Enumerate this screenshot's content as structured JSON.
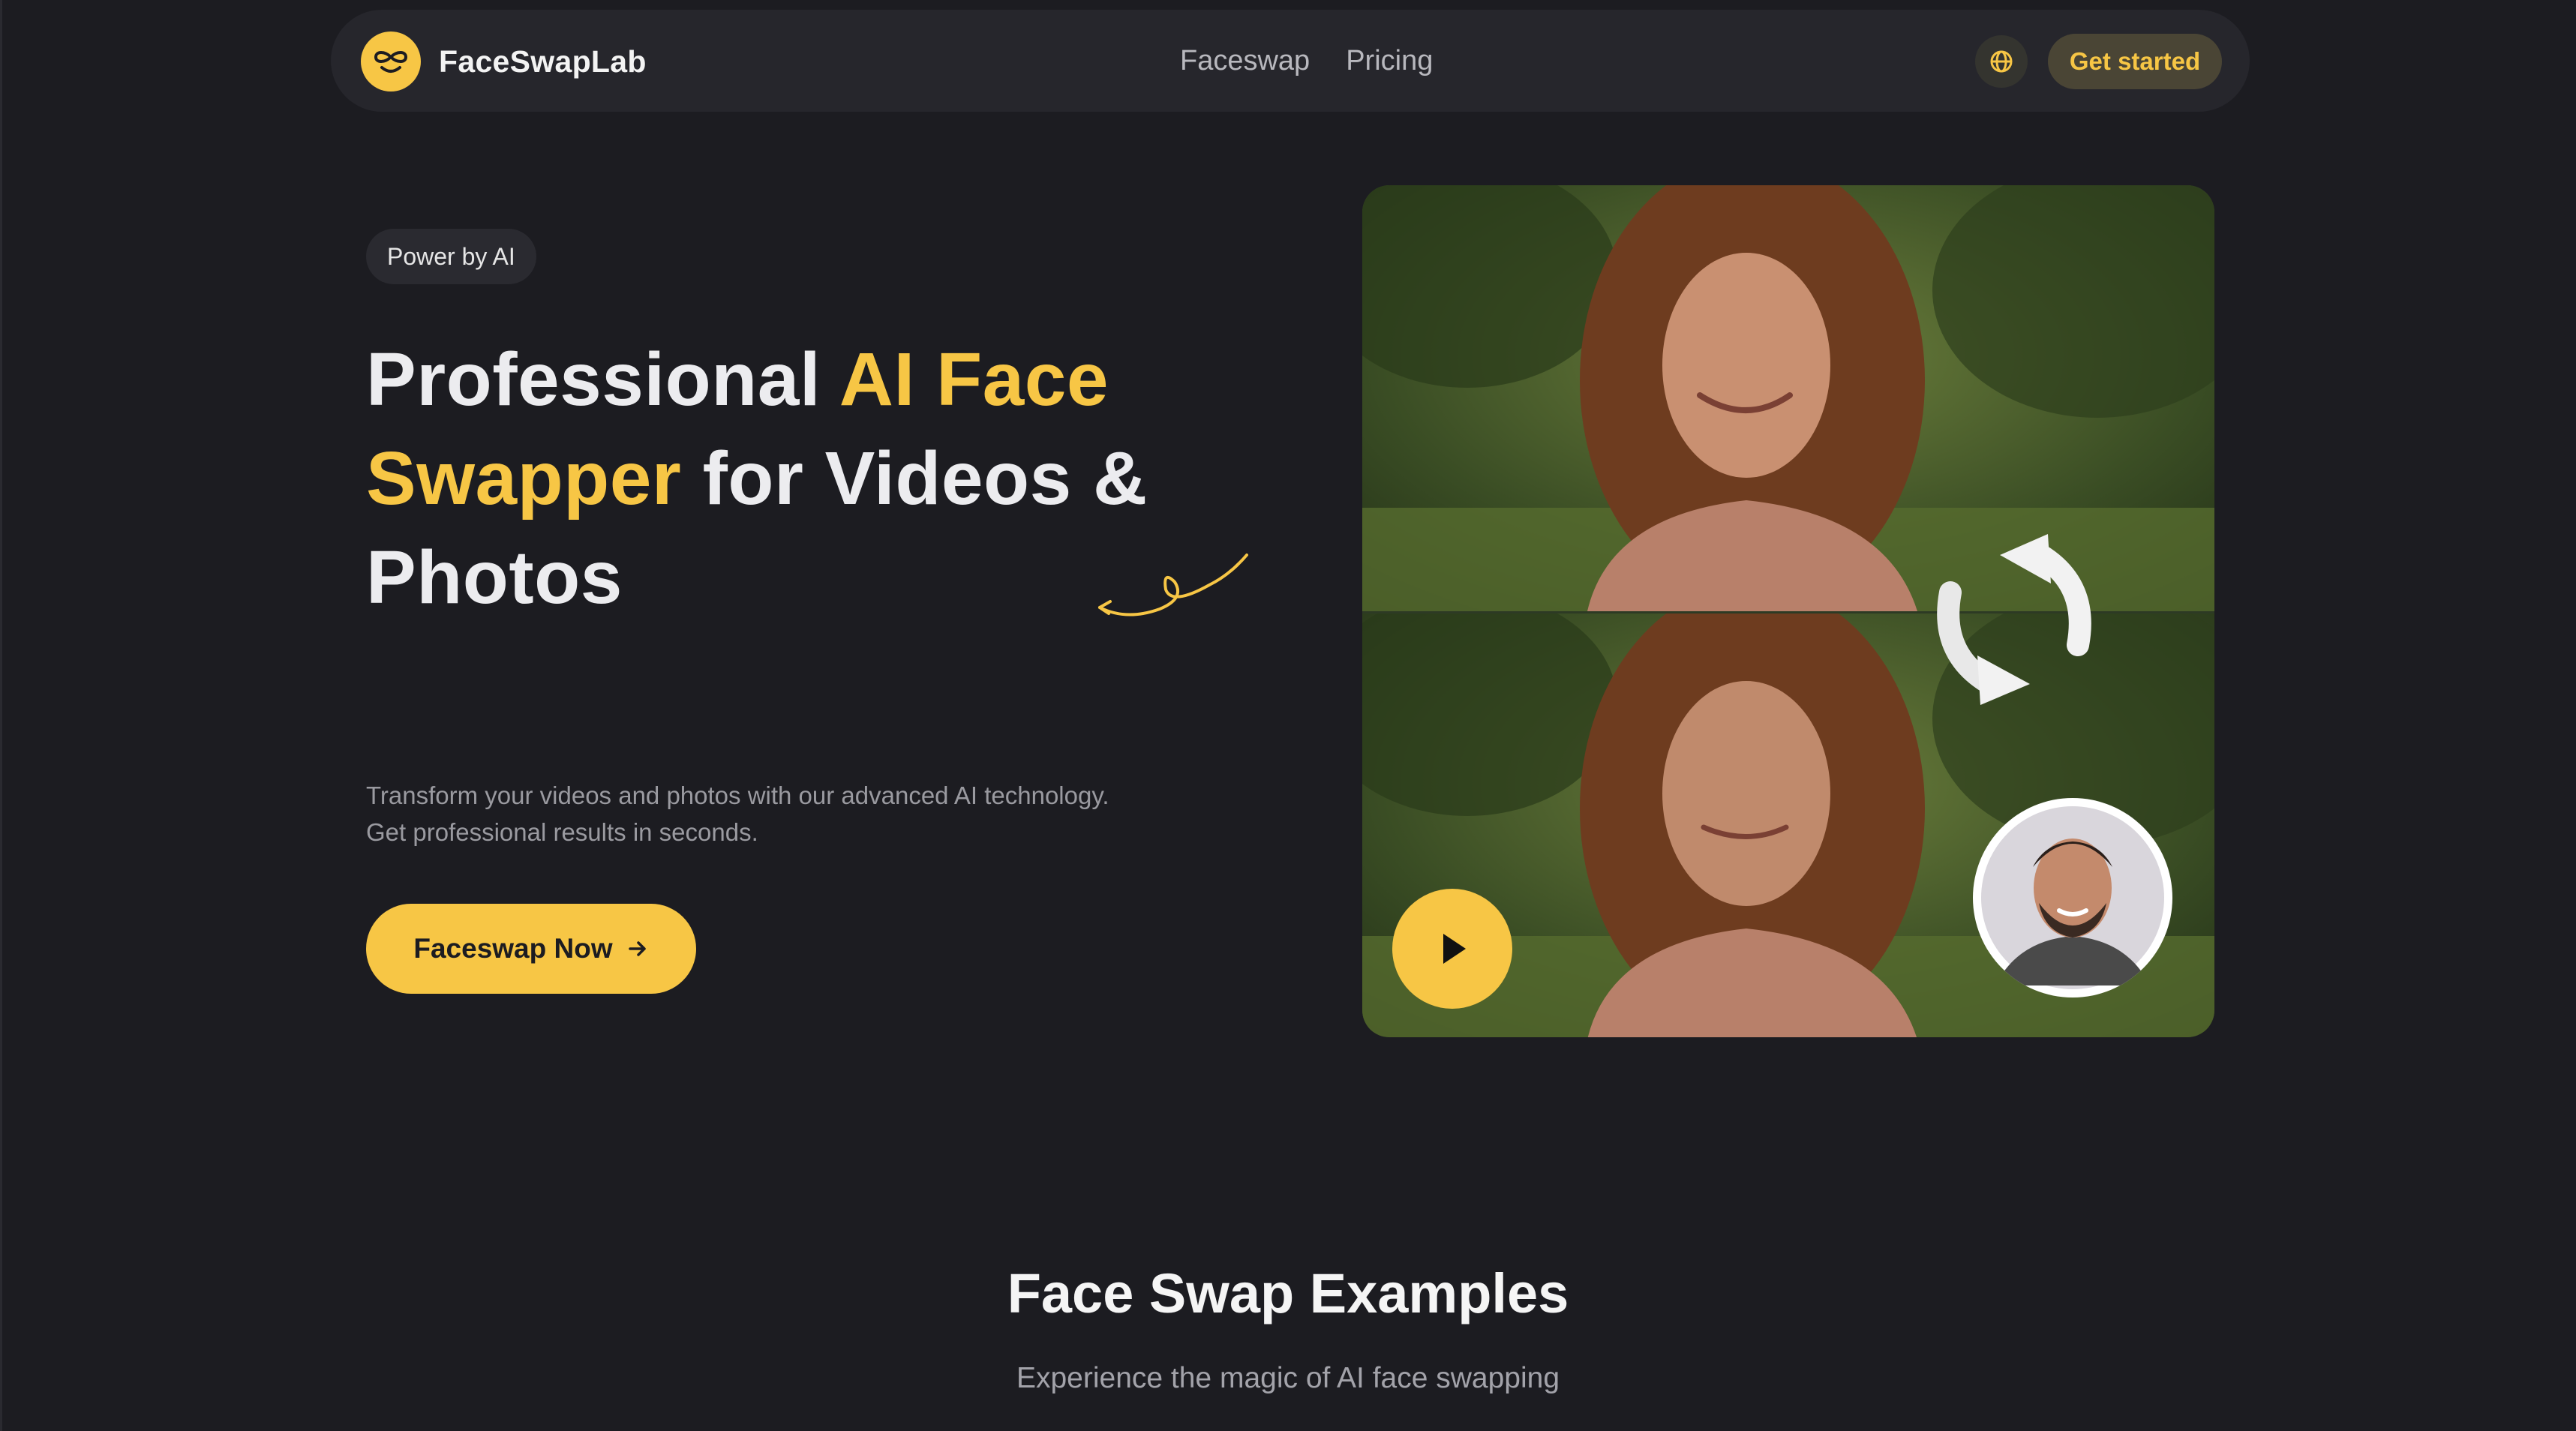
{
  "nav": {
    "brand": "FaceSwapLab",
    "links": [
      "Faceswap",
      "Pricing"
    ],
    "get_started": "Get started",
    "icons": {
      "logo": "infinity-face-icon",
      "language": "globe-icon"
    }
  },
  "hero": {
    "badge": "Power by AI",
    "title_part1": "Professional ",
    "title_accent": "AI Face Swapper",
    "title_part2": " for Videos & Photos",
    "description_line1": "Transform your videos and photos with our advanced AI technology.",
    "description_line2": "Get professional results in seconds.",
    "cta": "Faceswap Now"
  },
  "examples": {
    "title": "Face Swap Examples",
    "subtitle": "Experience the magic of AI face swapping"
  },
  "colors": {
    "background": "#1c1c21",
    "accent": "#f7c645",
    "nav_bg": "#26262c",
    "muted_text": "#9a9aa0"
  }
}
